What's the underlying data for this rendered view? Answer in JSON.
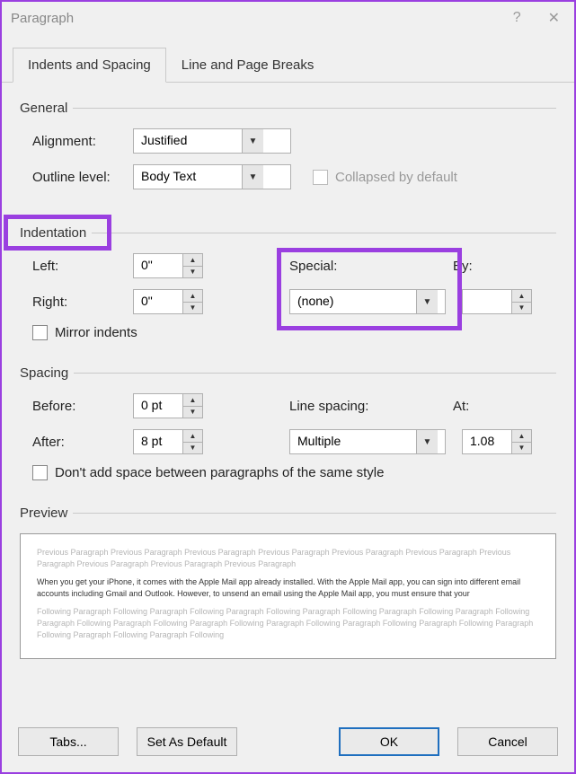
{
  "title": "Paragraph",
  "tabs": {
    "t0": "Indents and Spacing",
    "t1": "Line and Page Breaks"
  },
  "general": {
    "title": "General",
    "alignment_label": "Alignment:",
    "alignment_value": "Justified",
    "outline_label": "Outline level:",
    "outline_value": "Body Text",
    "collapsed_label": "Collapsed by default"
  },
  "indentation": {
    "title": "Indentation",
    "left_label": "Left:",
    "left_value": "0\"",
    "right_label": "Right:",
    "right_value": "0\"",
    "special_label": "Special:",
    "special_value": "(none)",
    "by_label": "By:",
    "by_value": "",
    "mirror_label": "Mirror indents"
  },
  "spacing": {
    "title": "Spacing",
    "before_label": "Before:",
    "before_value": "0 pt",
    "after_label": "After:",
    "after_value": "8 pt",
    "line_label": "Line spacing:",
    "line_value": "Multiple",
    "at_label": "At:",
    "at_value": "1.08",
    "dontadd_label": "Don't add space between paragraphs of the same style"
  },
  "preview": {
    "title": "Preview",
    "filler_prev": "Previous Paragraph Previous Paragraph Previous Paragraph Previous Paragraph Previous Paragraph Previous Paragraph Previous Paragraph Previous Paragraph Previous Paragraph Previous Paragraph",
    "sample": "When you get your iPhone, it comes with the Apple Mail app already installed. With the Apple Mail app, you can sign into different email accounts including Gmail and Outlook. However, to unsend an email using the Apple Mail app, you must ensure that your",
    "filler_next": "Following Paragraph Following Paragraph Following Paragraph Following Paragraph Following Paragraph Following Paragraph Following Paragraph Following Paragraph Following Paragraph Following Paragraph Following Paragraph Following Paragraph Following Paragraph Following Paragraph Following Paragraph Following"
  },
  "footer": {
    "tabs": "Tabs...",
    "setdefault": "Set As Default",
    "ok": "OK",
    "cancel": "Cancel"
  }
}
